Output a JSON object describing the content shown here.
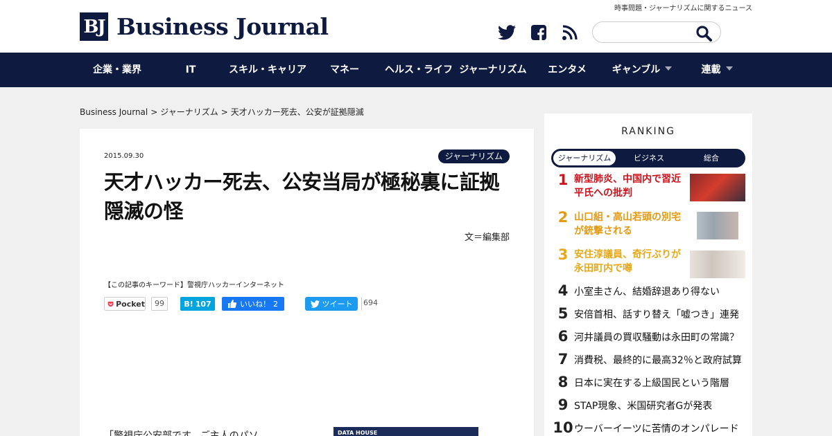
{
  "header": {
    "logo_mark": "BJ",
    "logo_text": "Business Journal",
    "tagline": "時事問題・ジャーナリズムに関するニュース",
    "social": [
      "twitter-icon",
      "facebook-icon",
      "rss-icon"
    ],
    "search": {
      "value": "",
      "placeholder": ""
    }
  },
  "nav": {
    "items": [
      {
        "label": "企業・業界"
      },
      {
        "label": "IT"
      },
      {
        "label": "スキル・キャリア"
      },
      {
        "label": "マネー"
      },
      {
        "label": "ヘルス・ライフ"
      },
      {
        "label": "ジャーナリズム"
      },
      {
        "label": "エンタメ"
      },
      {
        "label": "ギャンブル"
      },
      {
        "label": "連載"
      }
    ]
  },
  "breadcrumb": {
    "home": "Business Journal",
    "sep": ">",
    "category": "ジャーナリズム",
    "current": "天才ハッカー死去、公安が証拠隠滅"
  },
  "article": {
    "date": "2015.09.30",
    "category": "ジャーナリズム",
    "title": "天才ハッカー死去、公安当局が極秘裏に証拠隠滅の怪",
    "byline": "文＝編集部",
    "keywords_prefix": "【この記事のキーワード】",
    "keywords": [
      "警視庁",
      "ハッカー",
      "インターネット"
    ],
    "share": {
      "pocket_label": "Pocket",
      "pocket_count": "99",
      "hatena_label": "B!",
      "hatena_count": "107",
      "fb_label": "いいね！",
      "fb_count": "2",
      "tweet_label": "ツイート",
      "tweet_count": "694"
    },
    "lead": "「警視庁公安部です。ご主人のパソ",
    "thumb_caption": "DATA HOUSE"
  },
  "sidebar": {
    "title": "RANKING",
    "tabs": [
      "ジャーナリズム",
      "ビジネス",
      "総合"
    ],
    "active_tab": 0,
    "items": [
      {
        "rank": "1",
        "line1": "新型肺炎、中国内で習近",
        "line2": "平氏への批判",
        "color": "#d0121b"
      },
      {
        "rank": "2",
        "line1": "山口組・高山若頭の別宅",
        "line2": "が銃撃される",
        "color": "#e59a13"
      },
      {
        "rank": "3",
        "line1": "安住淳議員、奇行ぶりが",
        "line2": "永田町内で噂",
        "color": "#e7a91a"
      },
      {
        "rank": "4",
        "line1": "小室圭さん、結婚辞退あり得ない"
      },
      {
        "rank": "5",
        "line1": "安倍首相、話すり替え「嘘つき」連発"
      },
      {
        "rank": "6",
        "line1": "河井議員の買収騒動は永田町の常識？"
      },
      {
        "rank": "7",
        "line1": "消費税、最終的に最高32％と政府試算"
      },
      {
        "rank": "8",
        "line1": "日本に実在する上級国民という階層"
      },
      {
        "rank": "9",
        "line1": "STAP現象、米国研究者Gが発表"
      },
      {
        "rank": "10",
        "line1": "ウーバーイーツに苦情のオンパレード"
      }
    ]
  },
  "colors": {
    "navy": "#0e1a3f",
    "rank1": "#d0121b",
    "rank2": "#e59a13",
    "rank3": "#e7a91a"
  }
}
